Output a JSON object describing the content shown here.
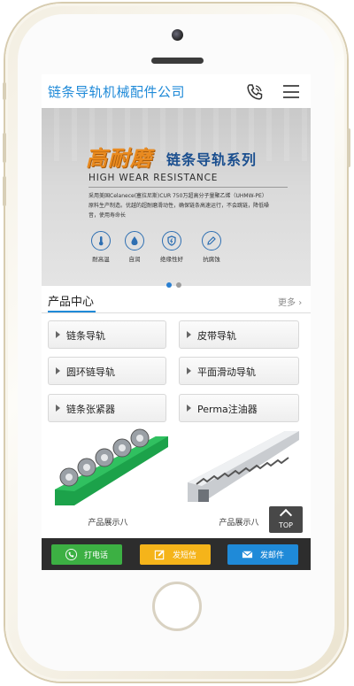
{
  "header": {
    "title": "链条导轨机械配件公司",
    "phone_icon": "phone-icon",
    "menu_icon": "menu-icon"
  },
  "banner": {
    "headline": "高耐磨",
    "series": "链条导轨系列",
    "english": "HIGH WEAR RESISTANCE",
    "description_line1": "采用美国Celanece(塞拉尼斯)CUR 750万超高分子量聚乙烯（UHMW-PE）",
    "description_line2": "原料生产制造。优越的超耐磨滑动性，确保链条高速运行，不会跳链，降低噪",
    "description_line3": "音，使用寿命长",
    "features": [
      {
        "icon": "thermometer-icon",
        "label": "耐高温"
      },
      {
        "icon": "drop-icon",
        "label": "自润"
      },
      {
        "icon": "shield-icon",
        "label": "绝缘性好"
      },
      {
        "icon": "pencil-icon",
        "label": "抗腐蚀"
      }
    ],
    "slides": 2,
    "active_slide": 1
  },
  "products_section": {
    "title": "产品中心",
    "more": "更多",
    "categories": [
      {
        "label": "链条导轨"
      },
      {
        "label": "皮带导轨"
      },
      {
        "label": "圆环链导轨"
      },
      {
        "label": "平面滑动导轨"
      },
      {
        "label": "链条张紧器"
      },
      {
        "label": "Perma注油器"
      }
    ],
    "items": [
      {
        "label": "产品展示八"
      },
      {
        "label": "产品展示八"
      }
    ]
  },
  "top_button": {
    "label": "TOP"
  },
  "bottom_bar": {
    "call": {
      "label": "打电话",
      "color": "#3cb043"
    },
    "sms": {
      "label": "发短信",
      "color": "#f5b41a"
    },
    "mail": {
      "label": "发邮件",
      "color": "#1f8ad8"
    }
  },
  "colors": {
    "accent": "#1f8ad8",
    "headline_orange": "#e98a1f",
    "series_blue": "#1b4f8f"
  }
}
